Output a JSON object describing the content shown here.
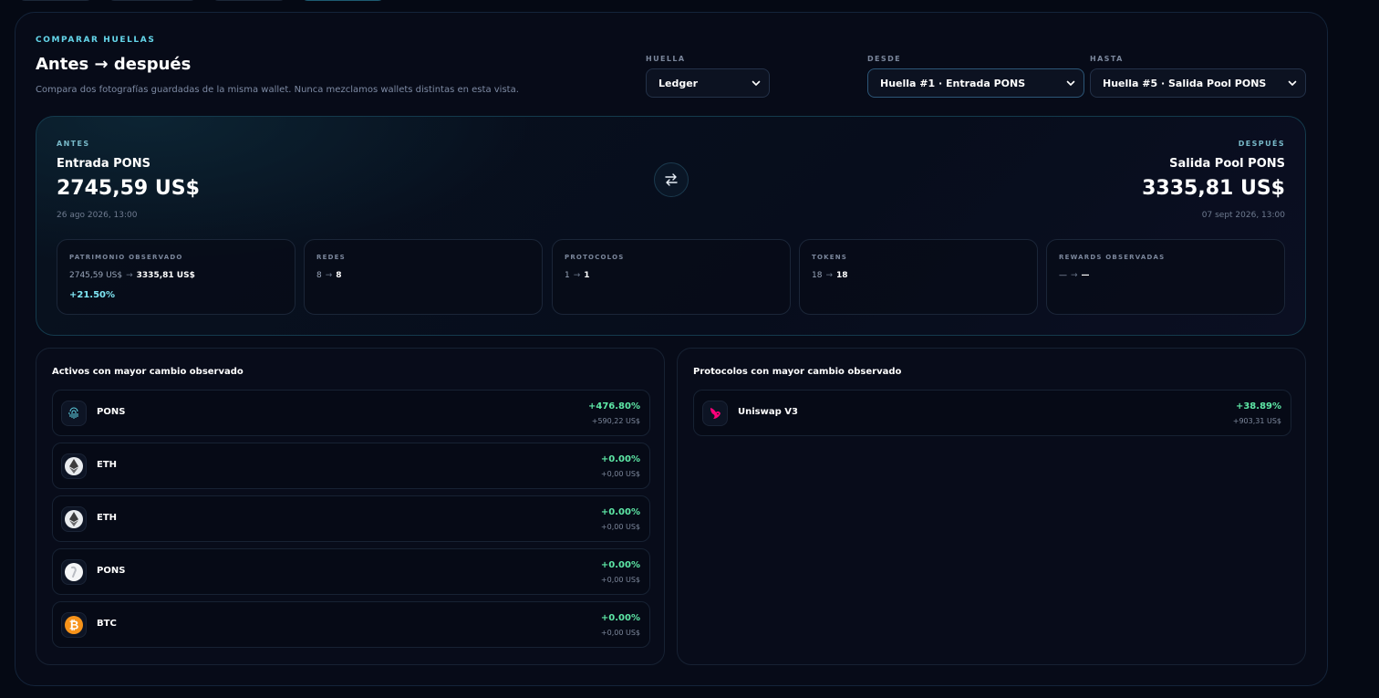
{
  "compare": {
    "eyebrow": "COMPARAR HUELLAS",
    "title": "Antes → después",
    "subtitle": "Compara dos fotografías guardadas de la misma wallet. Nunca mezclamos wallets distintas en esta vista."
  },
  "selectors": {
    "huella": {
      "label": "HUELLA",
      "value": "Ledger"
    },
    "desde": {
      "label": "DESDE",
      "value": "Huella #1 · Entrada PONS"
    },
    "hasta": {
      "label": "HASTA",
      "value": "Huella #5 · Salida Pool PONS"
    }
  },
  "before": {
    "label": "ANTES",
    "name": "Entrada PONS",
    "amount": "2745,59 US$",
    "date": "26 ago 2026, 13:00"
  },
  "after": {
    "label": "DESPUÉS",
    "name": "Salida Pool PONS",
    "amount": "3335,81 US$",
    "date": "07 sept 2026, 13:00"
  },
  "stats": [
    {
      "label": "PATRIMONIO OBSERVADO",
      "from": "2745,59 US$",
      "arrow": "→",
      "to": "3335,81 US$",
      "pct": "+21.50%"
    },
    {
      "label": "REDES",
      "from": "8",
      "arrow": "→",
      "to": "8"
    },
    {
      "label": "PROTOCOLOS",
      "from": "1",
      "arrow": "→",
      "to": "1"
    },
    {
      "label": "TOKENS",
      "from": "18",
      "arrow": "→",
      "to": "18"
    },
    {
      "label": "REWARDS OBSERVADAS",
      "from": "—",
      "arrow": "→",
      "to": "—"
    }
  ],
  "assets": {
    "title": "Activos con mayor cambio observado",
    "items": [
      {
        "name": "PONS",
        "pct": "+476.80%",
        "usd": "+590,22 US$",
        "icon": "pons-fingerprint-icon"
      },
      {
        "name": "ETH",
        "pct": "+0.00%",
        "usd": "+0,00 US$",
        "icon": "eth-icon"
      },
      {
        "name": "ETH",
        "pct": "+0.00%",
        "usd": "+0,00 US$",
        "icon": "eth-icon"
      },
      {
        "name": "PONS",
        "pct": "+0.00%",
        "usd": "+0,00 US$",
        "icon": "pons-token-icon"
      },
      {
        "name": "BTC",
        "pct": "+0.00%",
        "usd": "+0,00 US$",
        "icon": "btc-icon"
      }
    ]
  },
  "protocols": {
    "title": "Protocolos con mayor cambio observado",
    "items": [
      {
        "name": "Uniswap V3",
        "pct": "+38.89%",
        "usd": "+903,31 US$",
        "icon": "uniswap-icon"
      }
    ]
  },
  "colors": {
    "accent": "#64d6ea",
    "positive": "#5ee8a6",
    "background": "#050914"
  }
}
